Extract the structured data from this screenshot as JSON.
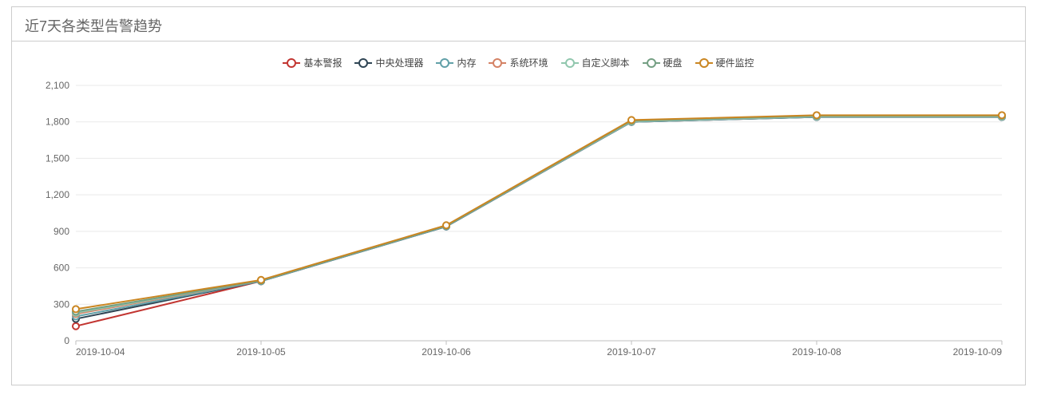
{
  "title": "近7天各类型告警趋势",
  "chart_data": {
    "type": "line",
    "x": [
      "2019-10-04",
      "2019-10-05",
      "2019-10-06",
      "2019-10-07",
      "2019-10-08",
      "2019-10-09"
    ],
    "ylim": [
      0,
      2100
    ],
    "yticks": [
      0,
      300,
      600,
      900,
      1200,
      1500,
      1800,
      2100
    ],
    "ytick_labels": [
      "0",
      "300",
      "600",
      "900",
      "1,200",
      "1,500",
      "1,800",
      "2,100"
    ],
    "series": [
      {
        "name": "基本警报",
        "color": "#c23531",
        "values": [
          120,
          490,
          940,
          1800,
          1840,
          1840
        ]
      },
      {
        "name": "中央处理器",
        "color": "#2f4554",
        "values": [
          180,
          490,
          940,
          1800,
          1840,
          1840
        ]
      },
      {
        "name": "内存",
        "color": "#61a0a8",
        "values": [
          200,
          490,
          940,
          1800,
          1840,
          1840
        ]
      },
      {
        "name": "系统环境",
        "color": "#d48265",
        "values": [
          220,
          495,
          945,
          1805,
          1845,
          1845
        ]
      },
      {
        "name": "自定义脚本",
        "color": "#91c7ae",
        "values": [
          230,
          495,
          945,
          1805,
          1845,
          1845
        ]
      },
      {
        "name": "硬盘",
        "color": "#749f83",
        "values": [
          240,
          495,
          945,
          1810,
          1850,
          1850
        ]
      },
      {
        "name": "硬件监控",
        "color": "#ca8622",
        "values": [
          260,
          500,
          950,
          1815,
          1855,
          1855
        ]
      }
    ]
  }
}
